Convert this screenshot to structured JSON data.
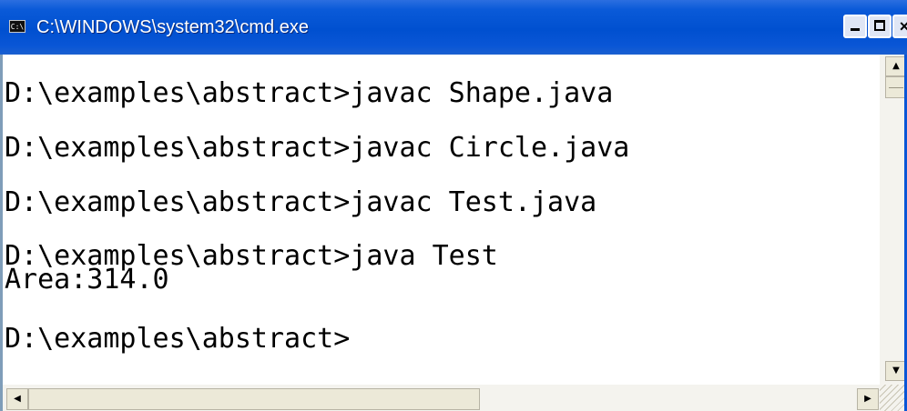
{
  "window": {
    "title": "C:\\WINDOWS\\system32\\cmd.exe",
    "icon_label": "C:\\",
    "icon": "console-app-icon"
  },
  "titlebar_buttons": {
    "minimize": "minimize-icon",
    "maximize": "maximize-icon",
    "close": "×"
  },
  "console": {
    "lines": [
      "D:\\examples\\abstract>javac Shape.java",
      "D:\\examples\\abstract>javac Circle.java",
      "D:\\examples\\abstract>javac Test.java",
      "D:\\examples\\abstract>java Test",
      "Area:314.0",
      "D:\\examples\\abstract>"
    ]
  },
  "scrollbars": {
    "up_arrow": "▲",
    "down_arrow": "▼",
    "left_arrow": "◀",
    "right_arrow": "▶"
  },
  "colors": {
    "titlebar": "#0050d0",
    "console_bg": "#ffffff",
    "console_text": "#000000"
  }
}
